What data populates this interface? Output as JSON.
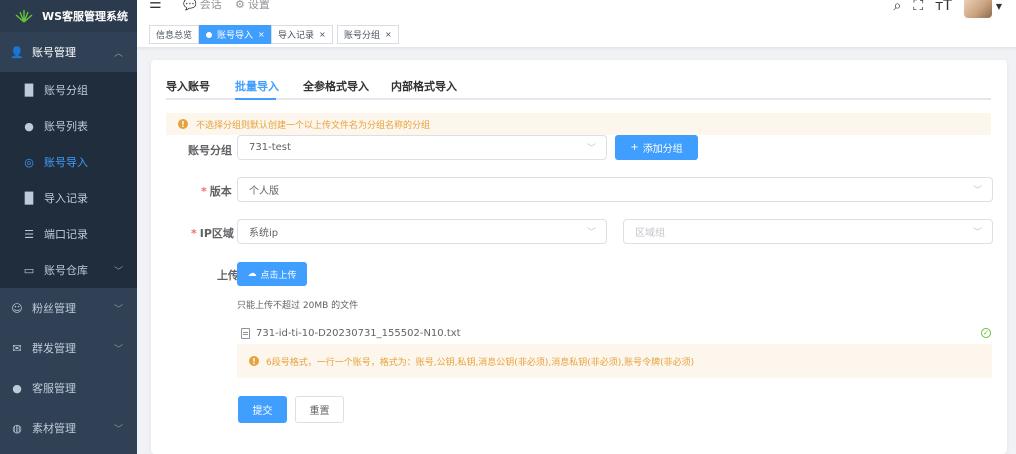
{
  "app": {
    "title": "WS客服管理系统"
  },
  "sidebar": {
    "groups": [
      {
        "label": "账号管理",
        "icon": "user-group-icon"
      },
      {
        "label": "粉丝管理",
        "icon": "fans-icon"
      },
      {
        "label": "群发管理",
        "icon": "mail-icon"
      },
      {
        "label": "客服管理",
        "icon": "user-icon"
      },
      {
        "label": "素材管理",
        "icon": "material-icon"
      }
    ],
    "subitems": [
      {
        "label": "账号分组",
        "icon": "bar-chart-icon"
      },
      {
        "label": "账号列表",
        "icon": "user-icon"
      },
      {
        "label": "账号导入",
        "icon": "eye-icon"
      },
      {
        "label": "导入记录",
        "icon": "bar-chart-icon"
      },
      {
        "label": "端口记录",
        "icon": "list-icon"
      },
      {
        "label": "账号仓库",
        "icon": "monitor-icon"
      }
    ]
  },
  "topbar": {
    "tabs": [
      {
        "label": "会话"
      },
      {
        "label": "设置"
      }
    ]
  },
  "tags": [
    {
      "label": "信息总览"
    },
    {
      "label": "账号导入"
    },
    {
      "label": "导入记录"
    },
    {
      "label": "账号分组"
    }
  ],
  "tabs": [
    {
      "label": "导入账号"
    },
    {
      "label": "批量导入"
    },
    {
      "label": "全参格式导入"
    },
    {
      "label": "内部格式导入"
    }
  ],
  "alert": {
    "text": "不选择分组则默认创建一个以上传文件名为分组名称的分组"
  },
  "form": {
    "group_label": "账号分组",
    "group_value": "731-test",
    "add_group_btn": "添加分组",
    "version_label": "版本",
    "version_value": "个人版",
    "ip_label": "IP区域",
    "ip_value": "系统ip",
    "region_placeholder": "区域组",
    "upload_label": "上传",
    "upload_btn": "点击上传",
    "upload_hint": "只能上传不超过 20MB 的文件",
    "file_name": "731-id-ti-10-D20230731_155502-N10.txt",
    "format_alert": "6段号格式，一行一个账号，格式为：账号,公钥,私钥,消息公钥(非必须),消息私钥(非必须),账号令牌(非必须)",
    "submit_btn": "提交",
    "reset_btn": "重置"
  },
  "colors": {
    "primary": "#409eff",
    "warning": "#e6a23c",
    "sidebar": "#304156",
    "success": "#67c23a"
  }
}
